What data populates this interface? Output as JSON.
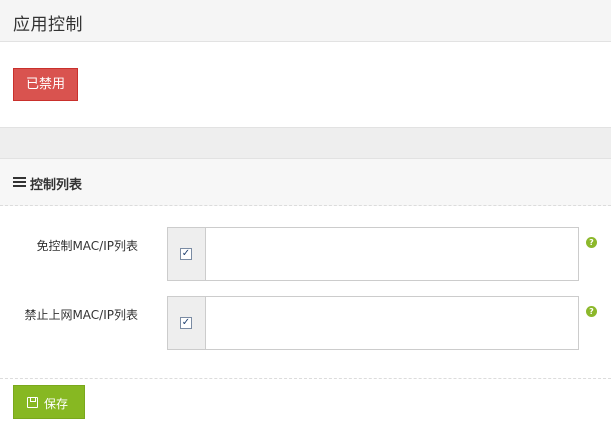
{
  "header": {
    "title": "应用控制"
  },
  "status": {
    "button_label": "已禁用",
    "color": "#d9534f"
  },
  "section": {
    "title": "控制列表",
    "icon": "list-icon"
  },
  "fields": [
    {
      "label": "免控制MAC/IP列表",
      "checked": true,
      "value": "",
      "help_icon": "question-icon"
    },
    {
      "label": "禁止上网MAC/IP列表",
      "checked": true,
      "value": "",
      "help_icon": "question-icon"
    }
  ],
  "help": {
    "glyph": "?"
  },
  "checkbox": {
    "mark": "✓"
  },
  "footer": {
    "save_label": "保存",
    "save_icon": "save-icon",
    "color": "#87b822"
  }
}
